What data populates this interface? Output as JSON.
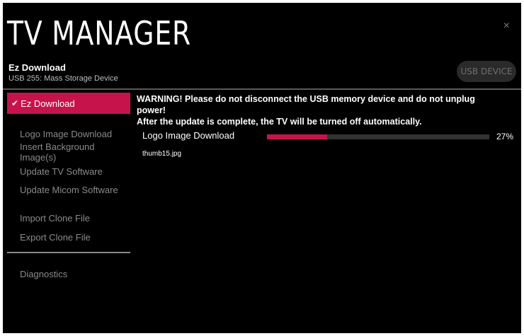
{
  "header": {
    "title": "TV MANAGER",
    "close_label": "×",
    "device_name": "Ez Download",
    "device_desc": "USB 255: Mass Storage Device",
    "usb_button_label": "USB DEVICE"
  },
  "sidebar": {
    "active": {
      "check": "✔",
      "label": "Ez Download"
    },
    "items": [
      {
        "label": "Logo Image Download"
      },
      {
        "label": "Insert Background Image(s)"
      },
      {
        "label": "Update TV Software"
      },
      {
        "label": "Update Micom Software"
      },
      {
        "label": "Import Clone File"
      },
      {
        "label": "Export Clone File"
      },
      {
        "label": "Diagnostics"
      }
    ]
  },
  "main": {
    "warning_line1": "WARNING! Please do not disconnect the USB memory device and do not unplug power!",
    "warning_line2": "After the update is complete, the TV will be turned off automatically.",
    "download_label": "Logo Image Download",
    "progress_percent": 27,
    "progress_text": "27%",
    "file_name": "thumb15.jpg"
  },
  "colors": {
    "accent": "#c7134c",
    "background": "#000000",
    "inactive_text": "#8a8a8a"
  }
}
